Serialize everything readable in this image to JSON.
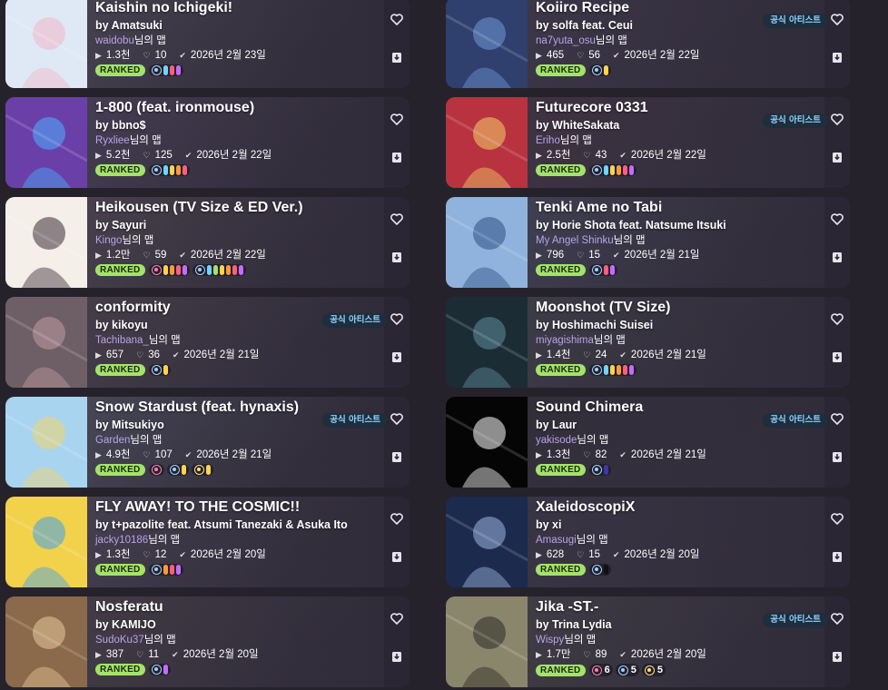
{
  "cards": [
    {
      "title": "Kaishin no Ichigeki!",
      "artist": "by Amatsuki",
      "mapper": "waidobu",
      "mapper_suffix": "님의 맵",
      "plays": "1.3천",
      "favs": "10",
      "date": "2026년 2월 23일",
      "status": "RANKED",
      "official": "",
      "modes": [
        {
          "mode": "osu",
          "colors": [
            "#6fd5ff",
            "#ff5f7a",
            "#c46cff"
          ]
        }
      ],
      "thumb": "#dfe9f5",
      "accent": "#f3b6c8",
      "bg": "#5c5866"
    },
    {
      "title": "Koiiro Recipe",
      "artist": "by solfa feat. Ceui",
      "mapper": "na7yuta_osu",
      "mapper_suffix": "님의 맵",
      "plays": "465",
      "favs": "56",
      "date": "2026년 2월 22일",
      "status": "RANKED",
      "official": "공식 아티스트",
      "modes": [
        {
          "mode": "osu",
          "colors": [
            "#ffd34d"
          ]
        }
      ],
      "thumb": "#2f3f6e",
      "accent": "#6f9ad8",
      "bg": "#474056"
    },
    {
      "title": "1-800 (feat. ironmouse)",
      "artist": "by bbno$",
      "mapper": "Ryxliee",
      "mapper_suffix": "님의 맵",
      "plays": "5.2천",
      "favs": "125",
      "date": "2026년 2월 22일",
      "status": "RANKED",
      "official": "",
      "modes": [
        {
          "mode": "osu",
          "colors": [
            "#6fd5ff",
            "#ffd34d",
            "#ff9a3c",
            "#ff5f7a"
          ]
        }
      ],
      "thumb": "#6b3fa8",
      "accent": "#4ab0ff",
      "bg": "#5a4f6e"
    },
    {
      "title": "Futurecore 0331",
      "artist": "by WhiteSakata",
      "mapper": "Eriho",
      "mapper_suffix": "님의 맵",
      "plays": "2.5천",
      "favs": "43",
      "date": "2026년 2월 22일",
      "status": "RANKED",
      "official": "공식 아티스트",
      "modes": [
        {
          "mode": "osu",
          "colors": [
            "#6fd5ff",
            "#ffd34d",
            "#ff9a3c",
            "#ff5f7a",
            "#c46cff"
          ]
        }
      ],
      "thumb": "#b8323f",
      "accent": "#f4d06a",
      "bg": "#4d3848"
    },
    {
      "title": "Heikousen (TV Size & ED Ver.)",
      "artist": "by Sayuri",
      "mapper": "Kingo",
      "mapper_suffix": "님의 맵",
      "plays": "1.2만",
      "favs": "59",
      "date": "2026년 2월 22일",
      "status": "RANKED",
      "official": "",
      "modes": [
        {
          "mode": "taiko",
          "colors": [
            "#ffd34d",
            "#ff9a3c",
            "#ff5f7a",
            "#c46cff"
          ]
        },
        {
          "mode": "osu",
          "colors": [
            "#6fd5ff",
            "#a4e36a",
            "#ffd34d",
            "#ff9a3c",
            "#ff5f7a",
            "#c46cff"
          ]
        }
      ],
      "thumb": "#f4efe9",
      "accent": "#3a2a35",
      "bg": "#615660"
    },
    {
      "title": "Tenki Ame no Tabi",
      "artist": "by Horie Shota feat. Natsume Itsuki",
      "mapper": "My Angel Shinku",
      "mapper_suffix": "님의 맵",
      "plays": "796",
      "favs": "15",
      "date": "2026년 2월 21일",
      "status": "RANKED",
      "official": "",
      "modes": [
        {
          "mode": "osu",
          "colors": [
            "#ff5f7a",
            "#c46cff"
          ]
        }
      ],
      "thumb": "#8fb3dc",
      "accent": "#2e4f86",
      "bg": "#4d546c"
    },
    {
      "title": "conformity",
      "artist": "by kikoyu",
      "mapper": "Tachibana_",
      "mapper_suffix": "님의 맵",
      "plays": "657",
      "favs": "36",
      "date": "2026년 2월 21일",
      "status": "RANKED",
      "official": "공식 아티스트",
      "modes": [
        {
          "mode": "osu",
          "colors": [
            "#ffd34d"
          ]
        }
      ],
      "thumb": "#6e5f66",
      "accent": "#c29ba2",
      "bg": "#5a5058"
    },
    {
      "title": "Moonshot (TV Size)",
      "artist": "by Hoshimachi Suisei",
      "mapper": "miyagishima",
      "mapper_suffix": "님의 맵",
      "plays": "1.4천",
      "favs": "24",
      "date": "2026년 2월 21일",
      "status": "RANKED",
      "official": "",
      "modes": [
        {
          "mode": "osu",
          "colors": [
            "#6fd5ff",
            "#ffd34d",
            "#ff9a3c",
            "#ff5f7a",
            "#c46cff"
          ]
        }
      ],
      "thumb": "#1c2c35",
      "accent": "#5f8f9c",
      "bg": "#474b52"
    },
    {
      "title": "Snow Stardust (feat. hynaxis)",
      "artist": "by Mitsukiyo",
      "mapper": "Garden",
      "mapper_suffix": "님의 맵",
      "plays": "4.9천",
      "favs": "107",
      "date": "2026년 2월 21일",
      "status": "RANKED",
      "official": "공식 아티스트",
      "modes": [
        {
          "mode": "taiko",
          "colors": []
        },
        {
          "mode": "osu",
          "colors": [
            "#ffd34d"
          ]
        },
        {
          "mode": "catch",
          "colors": [
            "#ffd34d"
          ]
        }
      ],
      "thumb": "#a8d4ef",
      "accent": "#f3d36a",
      "bg": "#5d6474"
    },
    {
      "title": "Sound Chimera",
      "artist": "by Laur",
      "mapper": "yakisode",
      "mapper_suffix": "님의 맵",
      "plays": "1.3천",
      "favs": "82",
      "date": "2026년 2월 21일",
      "status": "RANKED",
      "official": "공식 아티스트",
      "modes": [
        {
          "mode": "osu",
          "colors": [
            "#3a3aa8"
          ]
        }
      ],
      "thumb": "#050505",
      "accent": "#ffffff",
      "bg": "#2f2d36"
    },
    {
      "title": "FLY AWAY! TO THE COSMIC!!",
      "artist": "by t+pazolite feat. Atsumi Tanezaki & Asuka Ito",
      "mapper": "jacky10186",
      "mapper_suffix": "님의 맵",
      "plays": "1.3천",
      "favs": "12",
      "date": "2026년 2월 20일",
      "status": "RANKED",
      "official": "",
      "modes": [
        {
          "mode": "osu",
          "colors": [
            "#ff9a3c",
            "#ff5f7a",
            "#c46cff"
          ]
        }
      ],
      "thumb": "#f2d24a",
      "accent": "#3fa0f0",
      "bg": "#5b5466"
    },
    {
      "title": "XaleidoscopiX",
      "artist": "by xi",
      "mapper": "Amasugi",
      "mapper_suffix": "님의 맵",
      "plays": "628",
      "favs": "15",
      "date": "2026년 2월 20일",
      "status": "RANKED",
      "official": "",
      "modes": [
        {
          "mode": "osu",
          "colors": [
            "#111111"
          ]
        }
      ],
      "thumb": "#1c2a4e",
      "accent": "#9fb7e0",
      "bg": "#403c4e"
    },
    {
      "title": "Nosferatu",
      "artist": "by KAMIJO",
      "mapper": "SudoKu37",
      "mapper_suffix": "님의 맵",
      "plays": "387",
      "favs": "11",
      "date": "2026년 2월 20일",
      "status": "RANKED",
      "official": "",
      "modes": [
        {
          "mode": "osu",
          "colors": [
            "#c46cff"
          ]
        }
      ],
      "thumb": "#8a6a4a",
      "accent": "#e8c89a",
      "bg": "#564c50"
    },
    {
      "title": "Jika -ST.-",
      "artist": "by Trina Lydia",
      "mapper": "Wispy",
      "mapper_suffix": "님의 맵",
      "plays": "1.7만",
      "favs": "89",
      "date": "2026년 2월 20일",
      "status": "RANKED",
      "official": "공식 아티스트",
      "modes": [
        {
          "mode": "taiko",
          "colors": [],
          "count": "6"
        },
        {
          "mode": "osu",
          "colors": [],
          "count": "5"
        },
        {
          "mode": "catch",
          "colors": [],
          "count": "5"
        }
      ],
      "thumb": "#8a866c",
      "accent": "#2c2b26",
      "bg": "#504e4e"
    }
  ],
  "icons": {
    "heart": "heart-icon",
    "download": "download-icon",
    "plays": "play-icon",
    "favs": "heart-small-icon",
    "date": "check-circle-icon"
  }
}
